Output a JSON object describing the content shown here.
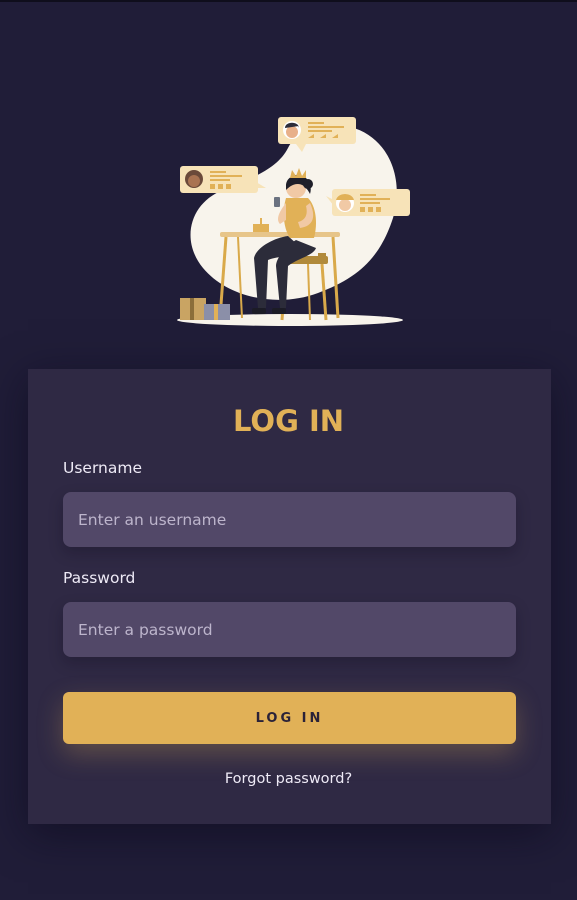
{
  "login": {
    "title": "LOG IN",
    "username_label": "Username",
    "username_placeholder": "Enter an username",
    "password_label": "Password",
    "password_placeholder": "Enter a password",
    "button_label": "LOG IN",
    "forgot_link": "Forgot password?"
  },
  "illustration": {
    "name": "woman-chatting-illustration"
  },
  "colors": {
    "background": "#201d38",
    "card": "#2f2944",
    "input": "#524868",
    "accent": "#e1b157",
    "text": "#eeeaf6"
  }
}
